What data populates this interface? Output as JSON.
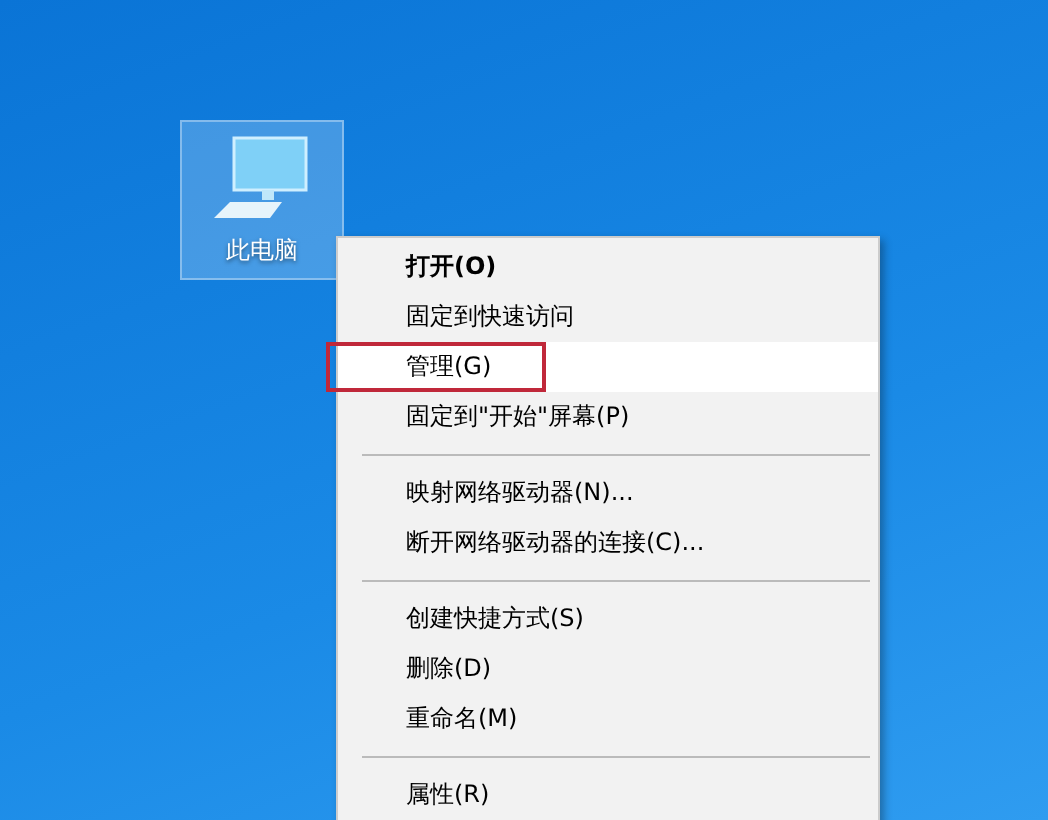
{
  "desktop_icon": {
    "label": "此电脑",
    "selected": true
  },
  "context_menu": {
    "items": [
      {
        "kind": "item",
        "label": "打开(O)",
        "default": true,
        "selected": false,
        "annotated": false
      },
      {
        "kind": "item",
        "label": "固定到快速访问",
        "default": false,
        "selected": false,
        "annotated": false
      },
      {
        "kind": "item",
        "label": "管理(G)",
        "default": false,
        "selected": true,
        "annotated": true
      },
      {
        "kind": "item",
        "label": "固定到\"开始\"屏幕(P)",
        "default": false,
        "selected": false,
        "annotated": false
      },
      {
        "kind": "separator"
      },
      {
        "kind": "item",
        "label": "映射网络驱动器(N)...",
        "default": false,
        "selected": false,
        "annotated": false
      },
      {
        "kind": "item",
        "label": "断开网络驱动器的连接(C)...",
        "default": false,
        "selected": false,
        "annotated": false
      },
      {
        "kind": "separator"
      },
      {
        "kind": "item",
        "label": "创建快捷方式(S)",
        "default": false,
        "selected": false,
        "annotated": false
      },
      {
        "kind": "item",
        "label": "删除(D)",
        "default": false,
        "selected": false,
        "annotated": false
      },
      {
        "kind": "item",
        "label": "重命名(M)",
        "default": false,
        "selected": false,
        "annotated": false
      },
      {
        "kind": "separator"
      },
      {
        "kind": "item",
        "label": "属性(R)",
        "default": false,
        "selected": false,
        "annotated": false
      }
    ]
  }
}
